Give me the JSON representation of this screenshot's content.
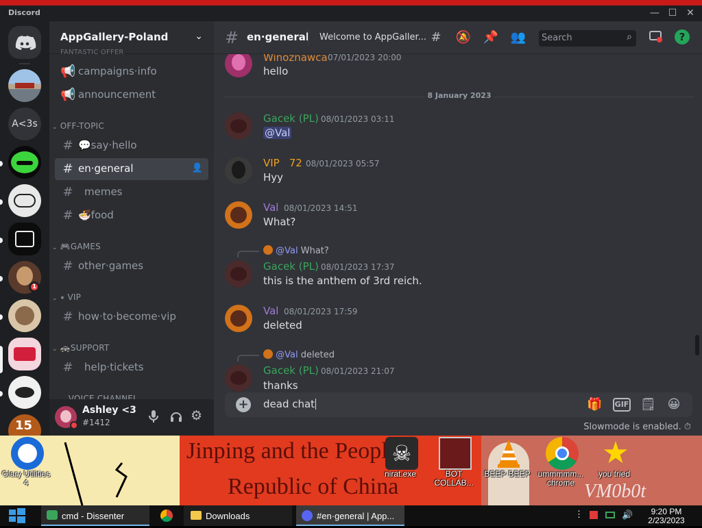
{
  "window": {
    "brand": "Discord",
    "controls": [
      "—",
      "☐",
      "✕"
    ]
  },
  "rail": {
    "text_server": "A<3s",
    "badge": "1"
  },
  "sidebar": {
    "server_name": "AppGallery-Poland",
    "partial_top": "FANTASTIC OFFER",
    "categories": {
      "offtopic": "OFF-TOPIC",
      "games": "🎮GAMES",
      "vip": "⭑ VIP",
      "support": "🚓SUPPORT",
      "voice": "VOICE CHANNEL"
    },
    "channels": {
      "campaigns": "campaigns·info",
      "announcement": "announcement",
      "say_hello": "💬say·hello",
      "general": "en·general",
      "memes": "memes",
      "food": "🍜food",
      "other_games": "other·games",
      "vip": "how·to·become·vip",
      "help": "help·tickets"
    }
  },
  "user": {
    "name": "Ashley <3",
    "tag": "#1412"
  },
  "header": {
    "channel": "en·general",
    "topic": "Welcome to AppGaller...",
    "search_placeholder": "Search",
    "help": "?"
  },
  "messages": {
    "date_divider": "8 January 2023",
    "m0": {
      "author": "Winoznawca",
      "time": "07/01/2023 20:00",
      "text": "hello"
    },
    "m1": {
      "author": "Gacek (PL)",
      "time": "08/01/2023 03:11",
      "text": "@Val"
    },
    "m2": {
      "author": "VIP",
      "author_num": "72",
      "time": "08/01/2023 05:57",
      "text": "Hyy"
    },
    "m3": {
      "author": "Val",
      "time": "08/01/2023 14:51",
      "text": "What?"
    },
    "m4": {
      "reply_mention": "@Val",
      "reply_text": "What?",
      "author": "Gacek (PL)",
      "time": "08/01/2023 17:37",
      "text": "this is the anthem of 3rd reich."
    },
    "m5": {
      "author": "Val",
      "time": "08/01/2023 17:59",
      "text": "deleted"
    },
    "m6": {
      "reply_mention": "@Val",
      "reply_text": "deleted",
      "author": "Gacek (PL)",
      "time": "08/01/2023 21:07",
      "text": "thanks"
    }
  },
  "composer": {
    "value": "dead chat",
    "gif": "GIF",
    "slowmode": "Slowmode is enabled."
  },
  "desktop": {
    "banner_line1": "Jinping and the People's",
    "banner_line2": "Republic of China",
    "icons": [
      {
        "label": "Glary Utilities 4"
      },
      {
        "label": "nirat.exe"
      },
      {
        "label": "BOT COLLAB..."
      },
      {
        "label": "BEEP BEEP"
      },
      {
        "label": "ummmmm... chrome"
      },
      {
        "label": "you tried"
      }
    ]
  },
  "taskbar": {
    "items": [
      "cmd - Dissenter",
      "Downloads",
      "#en·general | App..."
    ],
    "time": "9:20 PM",
    "date": "2/23/2023"
  },
  "colors": {
    "blurple": "#5865f2",
    "green_name": "#3ba55c",
    "vip_orange": "#f0a020",
    "val_purple": "#a07cd6"
  }
}
